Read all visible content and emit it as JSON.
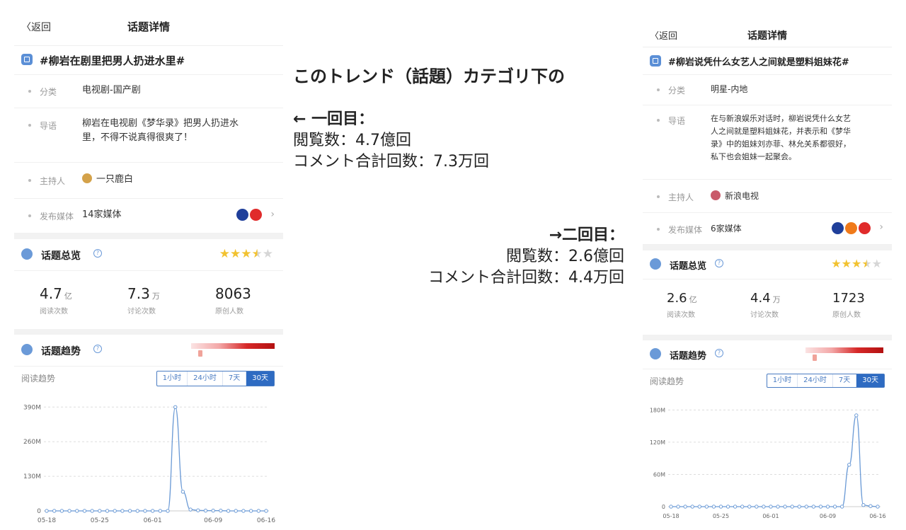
{
  "annotation": {
    "intro": "このトレンド（話題）カテゴリ下の",
    "first": {
      "heading": "← 一回目：",
      "views": "閲覧数：4.7億回",
      "comments": "コメント合計回数：7.3万回"
    },
    "second": {
      "heading": "→二回目：",
      "views": "閲覧数：2.6億回",
      "comments": "コメント合計回数：4.4万回"
    }
  },
  "left": {
    "back": "返回",
    "title": "话题详情",
    "topic": "#柳岩在剧里把男人扔进水里#",
    "category_label": "分类",
    "category": "电视剧-国产剧",
    "intro_label": "导语",
    "intro_line1": "柳岩在电视剧《梦华录》把男人扔进水",
    "intro_line2": "里，不得不说真得很爽了！",
    "host_label": "主持人",
    "host": "一只鹿白",
    "media_label": "发布媒体",
    "media": "14家媒体",
    "overview_title": "话题总览",
    "rating": 3.5,
    "stats": [
      {
        "value": "4.7",
        "unit": "亿",
        "label": "阅读次数"
      },
      {
        "value": "7.3",
        "unit": "万",
        "label": "讨论次数"
      },
      {
        "value": "8063",
        "unit": "",
        "label": "原创人数"
      }
    ],
    "trend_title": "话题趋势",
    "trend_label": "阅读趋势",
    "tabs": [
      "1小时",
      "24小时",
      "7天",
      "30天"
    ],
    "active_tab": "30天"
  },
  "right": {
    "back": "返回",
    "title": "话题详情",
    "topic": "#柳岩说凭什么女艺人之间就是塑料姐妹花#",
    "category_label": "分类",
    "category": "明星-内地",
    "intro_label": "导语",
    "intro_line1": "在与新浪娱乐对话时，柳岩说凭什么女艺",
    "intro_line2": "人之间就是塑料姐妹花，并表示和《梦华",
    "intro_line3": "录》中的姐妹刘亦菲、林允关系都很好，",
    "intro_line4": "私下也会姐妹一起聚会。",
    "host_label": "主持人",
    "host": "新浪电视",
    "media_label": "发布媒体",
    "media": "6家媒体",
    "overview_title": "话题总览",
    "rating": 3.5,
    "stats": [
      {
        "value": "2.6",
        "unit": "亿",
        "label": "阅读次数"
      },
      {
        "value": "4.4",
        "unit": "万",
        "label": "讨论次数"
      },
      {
        "value": "1723",
        "unit": "",
        "label": "原创人数"
      }
    ],
    "trend_title": "话题趋势",
    "trend_label": "阅读趋势",
    "tabs": [
      "1小时",
      "24小时",
      "7天",
      "30天"
    ],
    "active_tab": "30天"
  },
  "chart_data": [
    {
      "type": "line",
      "yticks": [
        "0",
        "130M",
        "260M",
        "390M"
      ],
      "yvalues": [
        0,
        130,
        260,
        390
      ],
      "ylim": [
        0,
        420
      ],
      "xticks": [
        "05-18",
        "05-25",
        "06-01",
        "06-09",
        "06-16"
      ],
      "x_tick_index": [
        0,
        7,
        14,
        22,
        29
      ],
      "values": [
        0,
        0,
        0,
        0,
        0,
        0,
        0,
        0,
        0,
        0,
        0,
        0,
        0,
        0,
        0,
        0,
        0,
        390,
        72,
        5,
        2,
        1,
        1,
        1,
        0,
        0,
        0,
        0,
        0,
        0
      ],
      "grid": true
    },
    {
      "type": "line",
      "yticks": [
        "0",
        "60M",
        "120M",
        "180M"
      ],
      "yvalues": [
        0,
        60,
        120,
        180
      ],
      "ylim": [
        0,
        195
      ],
      "xticks": [
        "05-18",
        "05-25",
        "06-01",
        "06-09",
        "06-16"
      ],
      "x_tick_index": [
        0,
        7,
        14,
        22,
        29
      ],
      "values": [
        0,
        0,
        0,
        0,
        0,
        0,
        0,
        0,
        0,
        0,
        0,
        0,
        0,
        0,
        0,
        0,
        0,
        0,
        0,
        0,
        0,
        0,
        0,
        0,
        0,
        78,
        170,
        3,
        1,
        0
      ],
      "grid": true
    }
  ]
}
